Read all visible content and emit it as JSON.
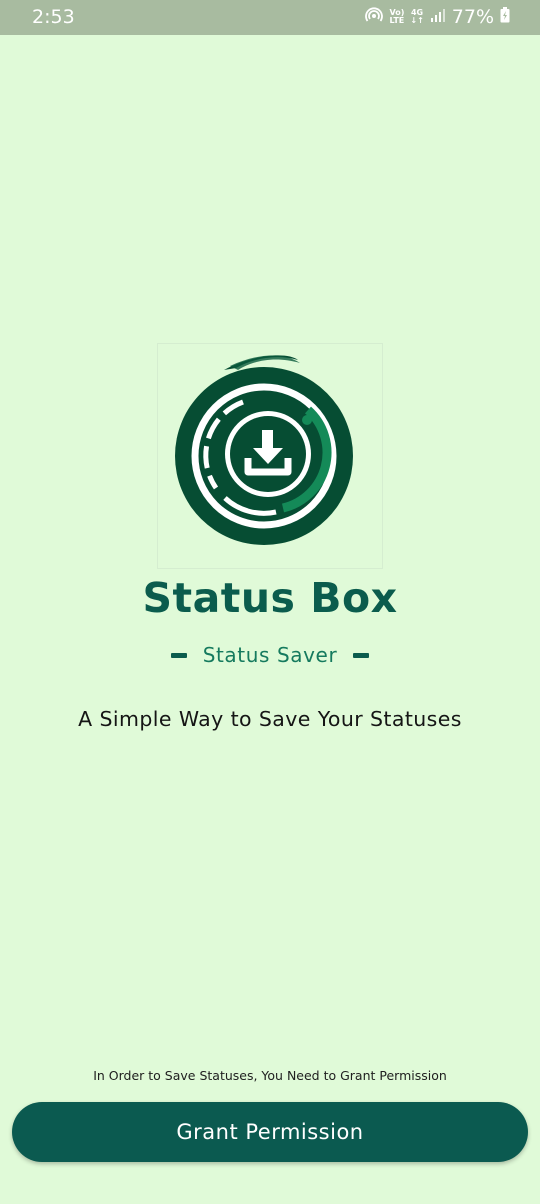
{
  "status_bar": {
    "time": "2:53",
    "volte_top": "Vo)",
    "volte_bottom": "LTE",
    "network_top": "4G",
    "network_bottom": "↓↑",
    "battery": "77%"
  },
  "app": {
    "name": "Status Box",
    "tagline": "Status Saver",
    "subtitle": "A Simple Way to Save Your Statuses"
  },
  "permission": {
    "note": "In Order to Save Statuses, You Need to Grant Permission",
    "button_label": "Grant Permission"
  },
  "colors": {
    "background": "#e0fad8",
    "brand_dark": "#0b5c4d",
    "button": "#0b5a50",
    "status_bar": "#a8bba0"
  },
  "icons": {
    "hotspot": "hotspot-icon",
    "signal": "signal-icon",
    "battery": "battery-charging-icon",
    "logo": "download-icon"
  }
}
